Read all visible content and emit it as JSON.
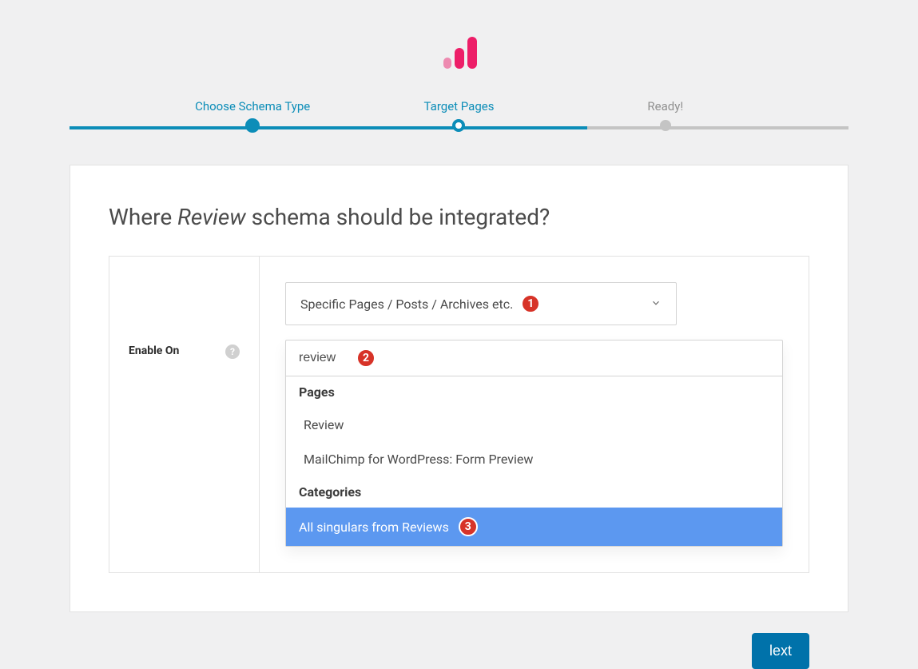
{
  "steps": {
    "step1": "Choose Schema Type",
    "step2": "Target Pages",
    "step3": "Ready!"
  },
  "heading": {
    "prefix": "Where ",
    "italic": "Review",
    "suffix": " schema should be integrated?"
  },
  "form": {
    "label": "Enable On",
    "select_value": "Specific Pages / Posts / Archives etc.",
    "search_value": "review",
    "badge1": "1",
    "badge2": "2",
    "badge3": "3"
  },
  "dropdown": {
    "group1_title": "Pages",
    "group1_item1": "Review",
    "group1_item2": "MailChimp for WordPress: Form Preview",
    "group2_title": "Categories",
    "group2_item1": "All singulars from Reviews"
  },
  "buttons": {
    "next": "lext"
  },
  "icons": {
    "help": "?"
  }
}
